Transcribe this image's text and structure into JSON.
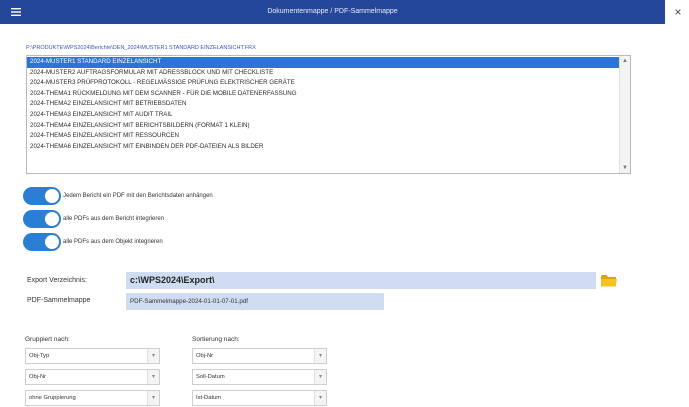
{
  "window": {
    "title": "Dokumentenmappe / PDF-Sammelmappe",
    "menu_icon": "hamburger-menu-icon",
    "close_label": "×"
  },
  "source_path": "P:\\PRODUKTE\\WPS2024\\Berichte\\DEN_2024\\MUSTER1 STANDARD EINZELANSICHT.FRX",
  "report_list": {
    "selected_index": 0,
    "items": [
      "2024-MUSTER1 STANDARD EINZELANSICHT",
      "2024-MUSTER2 AUFTRAGSFORMULAR MIT ADRESSBLOCK UND MIT CHECKLISTE",
      "2024-MUSTER3 PRÜFPROTOKOLL - REGELMÄSSIGE PRÜFUNG ELEKTRISCHER GERÄTE",
      "2024-THEMA1 RÜCKMELDUNG MIT DEM SCANNER - FÜR DIE MOBILE DATENERFASSUNG",
      "2024-THEMA2 EINZELANSICHT MIT BETRIEBSDATEN",
      "2024-THEMA3 EINZELANSICHT MIT AUDIT TRAIL",
      "2024-THEMA4 EINZELANSICHT MIT BERICHTSBILDERN (FORMAT 1 KLEIN)",
      "2024-THEMA5 EINZELANSICHT MIT RESSOURCEN",
      "2024-THEMA6 EINZELANSICHT MIT EINBINDEN DER PDF-DATEIEN ALS BILDER"
    ]
  },
  "toggles": [
    {
      "label": "Jedem Bericht ein PDF mit den Berichtsdaten anhängen",
      "on": true
    },
    {
      "label": "alle PDFs aus dem Bericht integrieren",
      "on": true
    },
    {
      "label": "alle PDFs aus dem Objekt integrieren",
      "on": true
    }
  ],
  "export": {
    "label": "Export Verzeichnis:",
    "value": "c:\\WPS2024\\Export\\",
    "folder_icon": "folder-icon",
    "folder_color": "#f2b817"
  },
  "pdf_file": {
    "label": "PDF-Sammelmappe",
    "value": "PDF-Sammelmappe-2024-01-01-07-01.pdf"
  },
  "grouping": {
    "label": "Gruppiert nach:",
    "options": [
      "Obj-Typ",
      "Obj-Nr",
      "ohne Gruppierung"
    ]
  },
  "sorting": {
    "label": "Sortierung nach:",
    "options": [
      "Obj-Nr",
      "Soll-Datum",
      "Ist-Datum"
    ]
  },
  "colors": {
    "titlebar": "#25479a",
    "selection": "#2d74d9",
    "toggle_on": "#2a7fd4",
    "field_bg": "#cfdcf1"
  }
}
